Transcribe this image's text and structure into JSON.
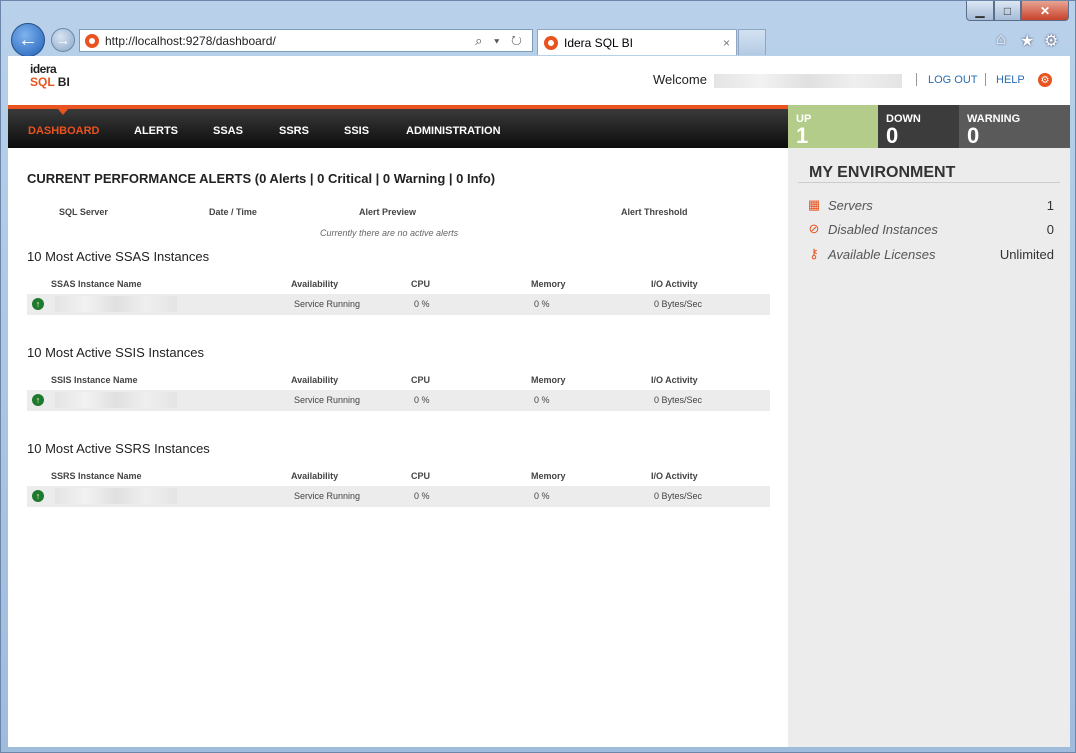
{
  "browser": {
    "url": "http://localhost:9278/dashboard/",
    "tab_title": "Idera SQL BI",
    "back": "←",
    "forward": "→",
    "addr_controls": "⌕ ▾ ↻",
    "tab_close": "×",
    "window": {
      "minimize": "▁",
      "maximize": "□",
      "close": "✕"
    },
    "tools": {
      "home": "⌂",
      "favorites": "★",
      "settings": "⚙"
    }
  },
  "header": {
    "logo_top": "idera",
    "logo_bottom_a": "SQL",
    "logo_bottom_b": "BI",
    "welcome": "Welcome",
    "logout": "LOG OUT",
    "help": "HELP",
    "settings_icon": "gear-icon"
  },
  "nav": {
    "items": [
      "DASHBOARD",
      "ALERTS",
      "SSAS",
      "SSRS",
      "SSIS",
      "ADMINISTRATION"
    ],
    "active": "DASHBOARD"
  },
  "status": {
    "up": {
      "label": "UP",
      "value": "1",
      "color": "#b3cc8a"
    },
    "down": {
      "label": "DOWN",
      "value": "0",
      "color": "#3c3c3c"
    },
    "warning": {
      "label": "WARNING",
      "value": "0",
      "color": "#5a5a5a"
    }
  },
  "alerts": {
    "title": "CURRENT PERFORMANCE ALERTS (0 Alerts | 0 Critical | 0 Warning | 0 Info)",
    "columns": [
      "SQL Server",
      "Date / Time",
      "Alert Preview",
      "Alert Threshold"
    ],
    "empty_message": "Currently there are no active alerts"
  },
  "sections": [
    {
      "title": "10 Most Active SSAS Instances",
      "columns": [
        "SSAS Instance Name",
        "Availability",
        "CPU",
        "Memory",
        "I/O Activity"
      ],
      "row": {
        "availability": "Service Running",
        "cpu": "0 %",
        "memory": "0 %",
        "io": "0 Bytes/Sec"
      }
    },
    {
      "title": "10 Most Active SSIS Instances",
      "columns": [
        "SSIS Instance Name",
        "Availability",
        "CPU",
        "Memory",
        "I/O Activity"
      ],
      "row": {
        "availability": "Service Running",
        "cpu": "0 %",
        "memory": "0 %",
        "io": "0 Bytes/Sec"
      }
    },
    {
      "title": "10 Most Active SSRS Instances",
      "columns": [
        "SSRS Instance Name",
        "Availability",
        "CPU",
        "Memory",
        "I/O Activity"
      ],
      "row": {
        "availability": "Service Running",
        "cpu": "0 %",
        "memory": "0 %",
        "io": "0 Bytes/Sec"
      }
    }
  ],
  "environment": {
    "title": "MY ENVIRONMENT",
    "items": [
      {
        "label": "Servers",
        "value": "1",
        "icon": "server-icon"
      },
      {
        "label": "Disabled Instances",
        "value": "0",
        "icon": "disabled-icon"
      },
      {
        "label": "Available Licenses",
        "value": "Unlimited",
        "icon": "key-icon"
      }
    ]
  },
  "colors": {
    "accent": "#e8531f",
    "link": "#2a6db0",
    "up_icon": "#1e7a2c"
  }
}
